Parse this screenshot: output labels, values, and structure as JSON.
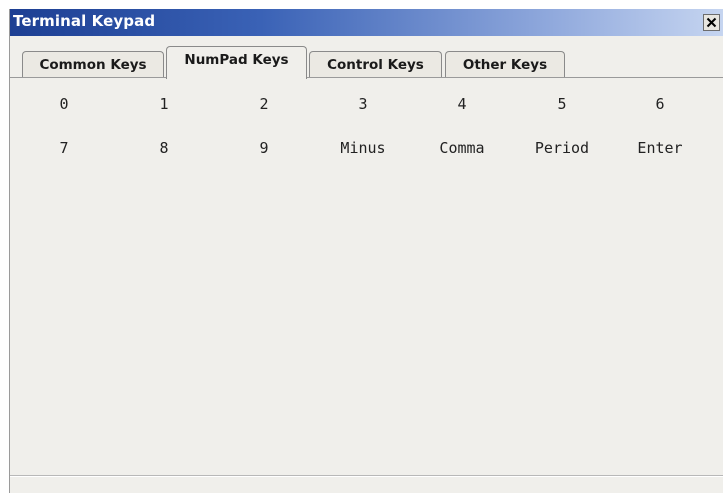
{
  "window": {
    "title": "Terminal Keypad",
    "close_label": "X"
  },
  "tabs": [
    {
      "label": "Common Keys",
      "active": false
    },
    {
      "label": "NumPad Keys",
      "active": true
    },
    {
      "label": "Control Keys",
      "active": false
    },
    {
      "label": "Other Keys",
      "active": false
    }
  ],
  "keys": {
    "row1": [
      "0",
      "1",
      "2",
      "3",
      "4",
      "5",
      "6"
    ],
    "row2": [
      "7",
      "8",
      "9",
      "Minus",
      "Comma",
      "Period",
      "Enter"
    ]
  },
  "colors": {
    "titlebar_start": "#1d3f93",
    "titlebar_end": "#c7d6f1",
    "panel_bg": "#f0efeb"
  }
}
